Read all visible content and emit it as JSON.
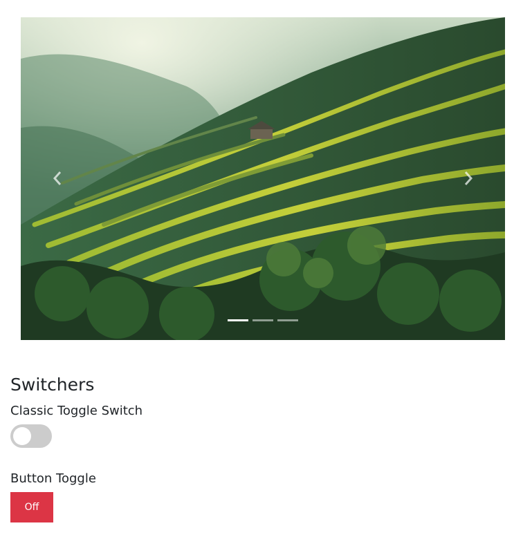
{
  "carousel": {
    "image_label": "terraced rice fields",
    "prev_icon": "chevron-left-icon",
    "next_icon": "chevron-right-icon",
    "slide_count": 3,
    "active_slide": 1
  },
  "switchers": {
    "title": "Switchers",
    "classic_label": "Classic Toggle Switch",
    "classic_state": "off",
    "button_label": "Button Toggle",
    "button_text": "Off",
    "button_color": "#dc3545",
    "toggle_track_color": "#cccccc"
  }
}
